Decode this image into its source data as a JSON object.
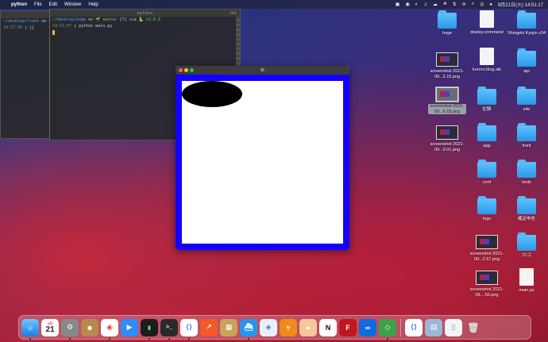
{
  "menubar": {
    "apple": "",
    "app": "python",
    "items": [
      "File",
      "Edit",
      "Window",
      "Help"
    ],
    "status_icons": [
      "▣",
      "◉",
      "◐",
      "♫",
      "☁",
      "⎈",
      "⇅",
      "≋",
      "⌕",
      "◎",
      "●"
    ],
    "clock": "9月21日(火) 14:51:17"
  },
  "terminal_back": {
    "line1_path": "~/desktop/front",
    "line1_on": " on ",
    "line1_branch": "🌱",
    "line2_time": "14:27:36",
    "line2_prompt": " ❯ ",
    "line2_cursor": "[]"
  },
  "terminal_front": {
    "title": "python",
    "shortcut": "⌥⌘2",
    "line1_path": "~/desktop/hoge",
    "line1_on": " on ",
    "line1_branch": "🌱 master",
    "line1_status": " [?] via ",
    "line1_py": "🐍 v3.8.8",
    "line2_time": "14:51:07",
    "line2_cmd": " ❯ python main.py"
  },
  "tk_window": {
    "title": "tk",
    "canvas_bg": "#ffffff",
    "border_color": "#1400ff",
    "shape_color": "#000000"
  },
  "desktop_icons": [
    {
      "label": "hoge",
      "kind": "folder"
    },
    {
      "label": "deploy.command",
      "kind": "doc"
    },
    {
      "label": "Shingeki Kyojin v34",
      "kind": "folder"
    },
    {
      "label": "screenshot 2021-09...2.15.png",
      "kind": "shot"
    },
    {
      "label": "kuroro.blog.stk",
      "kind": "doc"
    },
    {
      "label": "api",
      "kind": "folder"
    },
    {
      "label": "screenshot 2021-09...6.15.png",
      "kind": "shot"
    },
    {
      "label": "記録",
      "kind": "folder"
    },
    {
      "label": "site",
      "kind": "folder"
    },
    {
      "label": "screenshot 2021-09...0.01.png",
      "kind": "shot"
    },
    {
      "label": "app",
      "kind": "folder"
    },
    {
      "label": "front",
      "kind": "folder"
    },
    {
      "label": "conf",
      "kind": "folder"
    },
    {
      "label": "tools",
      "kind": "folder"
    },
    {
      "label": "logs",
      "kind": "folder"
    },
    {
      "label": "確定申告",
      "kind": "folder"
    },
    {
      "label": "screenshot 2021-09...2.57.png",
      "kind": "shot"
    },
    {
      "label": "ロゴ",
      "kind": "folder"
    },
    {
      "label": "screenshot 2021-09....50.png",
      "kind": "shot"
    },
    {
      "label": "main.py",
      "kind": "doc"
    }
  ],
  "dock": {
    "calendar_month": "9月",
    "calendar_day": "21",
    "terminal1": "▮",
    "terminal2": ">_"
  }
}
